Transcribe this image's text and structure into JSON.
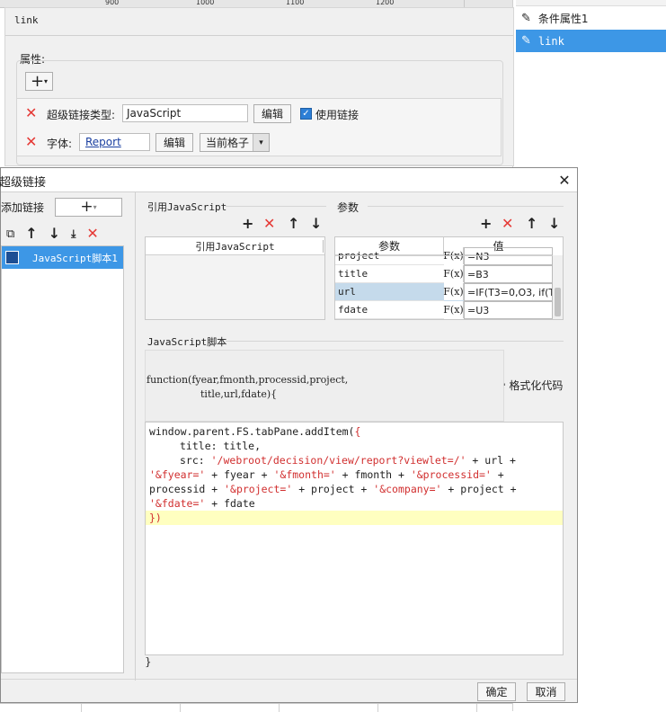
{
  "ruler": {
    "ticks": [
      "900",
      "1000",
      "1100",
      "1200"
    ]
  },
  "right_panel": {
    "items": [
      "条件属性1",
      "link"
    ]
  },
  "property_panel": {
    "name_value": "link",
    "properties_label": "属性:",
    "hyperlink_type_label": "超级链接类型:",
    "hyperlink_type_value": "JavaScript",
    "edit_label": "编辑",
    "use_link_label": "使用链接",
    "font_label": "字体:",
    "font_value": "Report",
    "cell_scope_value": "当前格子"
  },
  "dialog": {
    "title": "超级链接",
    "add_link_label": "添加链接",
    "link_items": [
      "JavaScript脚本1"
    ],
    "ref_js_section": "引用JavaScript",
    "ref_js_column": "引用JavaScript",
    "params_section": "参数",
    "params_columns": [
      "参数",
      "值"
    ],
    "params_rows": [
      {
        "name": "project",
        "value": "=N3"
      },
      {
        "name": "title",
        "value": "=B3"
      },
      {
        "name": "url",
        "value": "=IF(T3=0,O3, if(T"
      },
      {
        "name": "fdate",
        "value": "=U3"
      }
    ],
    "fx_label": "F(x)",
    "script_section": "JavaScript脚本",
    "function_signature_1": "function(fyear,fmonth,processid,project,",
    "function_signature_2": "title,url,fdate){",
    "format_code_label": "格式化代码",
    "code": {
      "l1_a": "window.parent.FS.tabPane.addItem(",
      "l1_b": "{",
      "l2": "title: title,",
      "l3_a": "src: ",
      "l3_b": "'/webroot/decision/view/report?viewlet=/'",
      "l3_c": " + url +",
      "l4_a": "'&fyear='",
      "l4_b": " + fyear + ",
      "l4_c": "'&fmonth='",
      "l4_d": " + fmonth + ",
      "l4_e": "'&processid='",
      "l4_f": " +",
      "l5_a": "processid + ",
      "l5_b": "'&project='",
      "l5_c": " + project + ",
      "l5_d": "'&company='",
      "l5_e": " + project +",
      "l6_a": "'&fdate='",
      "l6_b": " + fdate",
      "l7": "})",
      "closing_brace": "}"
    },
    "ok_label": "确定",
    "cancel_label": "取消"
  },
  "colors": {
    "accent": "#3d97e6",
    "delete_red": "#e53935",
    "code_string": "#d12f2f",
    "highlight_line": "#ffffc0"
  }
}
